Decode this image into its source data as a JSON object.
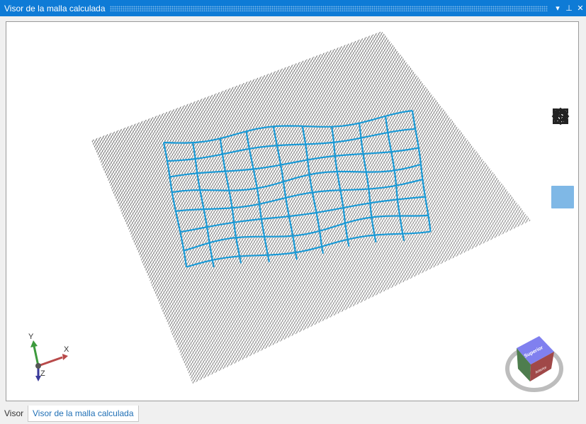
{
  "window": {
    "title": "Visor de la malla calculada",
    "controls": [
      "▾",
      "⊥",
      "✕"
    ]
  },
  "toolbar": {
    "tools": [
      {
        "name": "home-icon",
        "active": false
      },
      {
        "name": "eye-icon",
        "active": false
      },
      {
        "name": "zoom-window-icon",
        "active": false
      },
      {
        "name": "zoom-icon",
        "active": true
      },
      {
        "name": "pan-icon",
        "active": false
      },
      {
        "name": "rotate-icon",
        "active": false
      },
      {
        "name": "fit-extents-icon",
        "active": false
      },
      {
        "name": "settings-icon",
        "active": false
      }
    ]
  },
  "axes": {
    "x": "X",
    "y": "Y",
    "z": "Z"
  },
  "view_cube": {
    "face_top": "Superior",
    "face_front": "Anterior"
  },
  "tabs": [
    {
      "label": "Visor",
      "active": false
    },
    {
      "label": "Visor de la malla calculada",
      "active": true
    }
  ],
  "colors": {
    "title_bar": "#0e7bd6",
    "mesh": "#111111",
    "grid": "#1a9ad6",
    "active_tool": "#7fb8e6"
  }
}
